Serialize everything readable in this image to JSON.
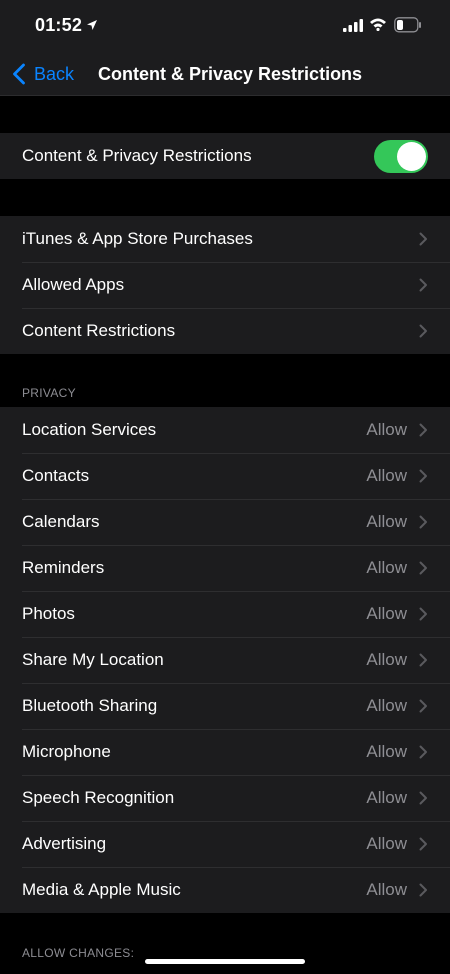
{
  "status_bar": {
    "time": "01:52",
    "icons": [
      "location-arrow-icon",
      "cellular-signal-icon",
      "wifi-icon",
      "battery-icon"
    ]
  },
  "nav": {
    "back_label": "Back",
    "title": "Content & Privacy Restrictions"
  },
  "master": {
    "label": "Content & Privacy Restrictions",
    "enabled": true,
    "toggle_color": "#34c759"
  },
  "store_group": [
    {
      "label": "iTunes & App Store Purchases"
    },
    {
      "label": "Allowed Apps"
    },
    {
      "label": "Content Restrictions"
    }
  ],
  "privacy": {
    "header": "PRIVACY",
    "items": [
      {
        "label": "Location Services",
        "value": "Allow"
      },
      {
        "label": "Contacts",
        "value": "Allow"
      },
      {
        "label": "Calendars",
        "value": "Allow"
      },
      {
        "label": "Reminders",
        "value": "Allow"
      },
      {
        "label": "Photos",
        "value": "Allow"
      },
      {
        "label": "Share My Location",
        "value": "Allow"
      },
      {
        "label": "Bluetooth Sharing",
        "value": "Allow"
      },
      {
        "label": "Microphone",
        "value": "Allow"
      },
      {
        "label": "Speech Recognition",
        "value": "Allow"
      },
      {
        "label": "Advertising",
        "value": "Allow"
      },
      {
        "label": "Media & Apple Music",
        "value": "Allow"
      }
    ]
  },
  "allow_changes": {
    "header": "ALLOW CHANGES:"
  },
  "colors": {
    "accent": "#0a84ff",
    "cell_background": "#1c1c1e",
    "secondary_text": "#8e8e93"
  }
}
